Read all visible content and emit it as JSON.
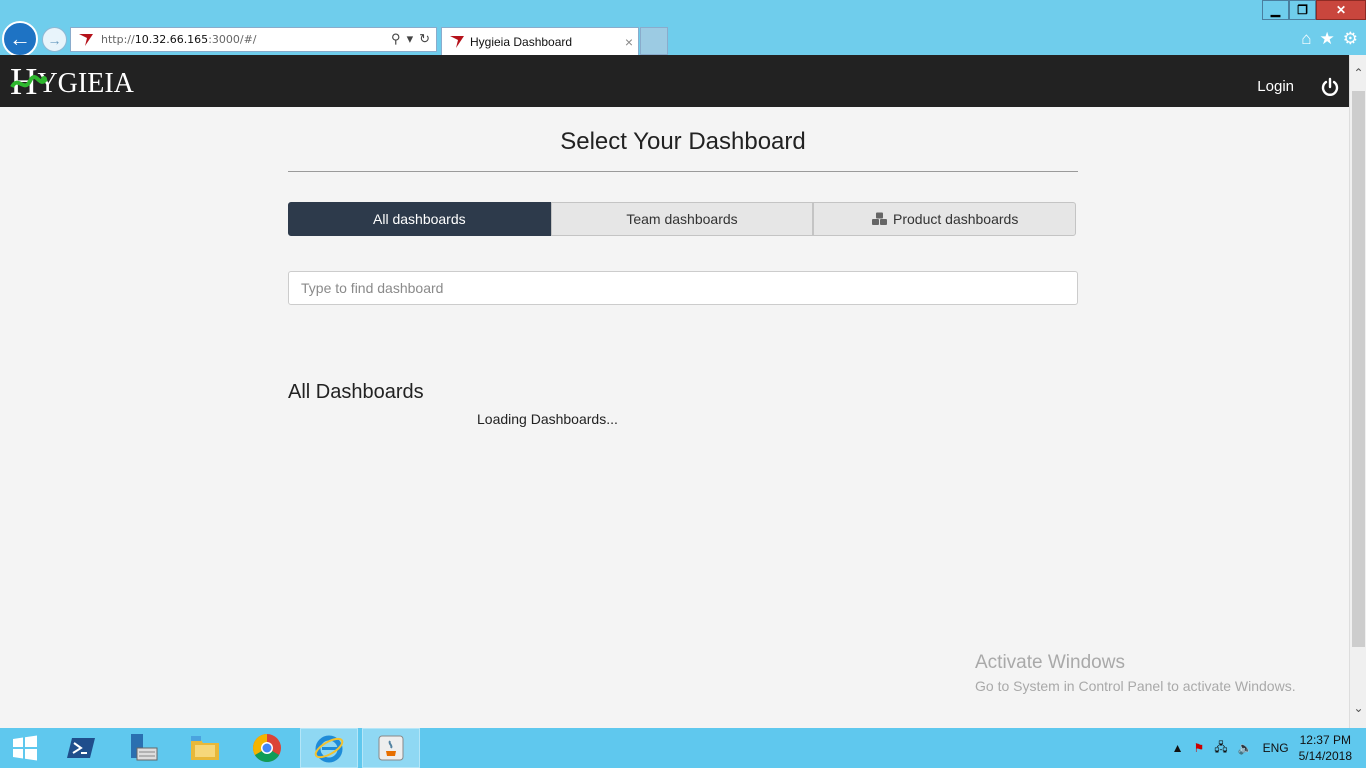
{
  "browser": {
    "url_proto": "http://",
    "url_host": "10.32.66.165",
    "url_path": ":3000/#/",
    "tab_title": "Hygieia Dashboard",
    "tab_close": "×"
  },
  "app": {
    "logo_first": "H",
    "logo_rest": "YGIEIA",
    "login_label": "Login"
  },
  "page": {
    "title": "Select Your Dashboard",
    "tabs": [
      {
        "label": "All dashboards",
        "active": true
      },
      {
        "label": "Team dashboards",
        "active": false
      },
      {
        "label": "Product dashboards",
        "active": false
      }
    ],
    "search_placeholder": "Type to find dashboard",
    "section_title": "All Dashboards",
    "loading_text": "Loading Dashboards..."
  },
  "watermark": {
    "title": "Activate Windows",
    "subtitle": "Go to System in Control Panel to activate Windows."
  },
  "taskbar": {
    "lang": "ENG",
    "time": "12:37 PM",
    "date": "5/14/2018",
    "items": [
      "start-icon",
      "powershell-icon",
      "server-manager-icon",
      "file-explorer-icon",
      "chrome-icon",
      "internet-explorer-icon",
      "java-icon"
    ]
  },
  "colors": {
    "chrome_bg": "#6fcdec",
    "nav_bg": "#222222",
    "active_tab": "#2d3a4b",
    "taskbar_bg": "#5fc8ee"
  }
}
